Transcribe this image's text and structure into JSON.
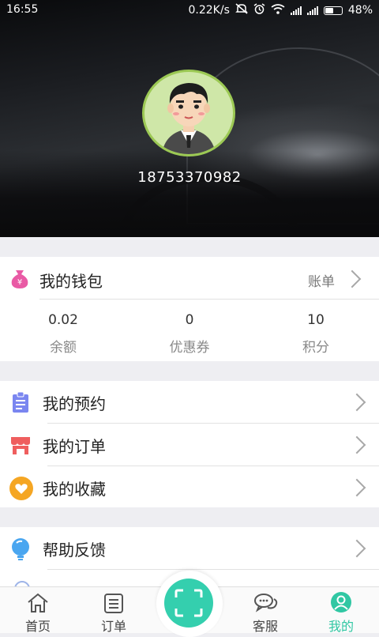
{
  "status_bar": {
    "time": "16:55",
    "speed": "0.22K/s",
    "battery": "48%",
    "battery_level": 0.48
  },
  "profile": {
    "phone": "18753370982"
  },
  "wallet": {
    "title": "我的钱包",
    "bill_link": "账单",
    "stats": [
      {
        "value": "0.02",
        "label": "余额"
      },
      {
        "value": "0",
        "label": "优惠券"
      },
      {
        "value": "10",
        "label": "积分"
      }
    ]
  },
  "menu": {
    "appointment": "我的预约",
    "orders": "我的订单",
    "favorites": "我的收藏",
    "help": "帮助反馈"
  },
  "nav": {
    "home": "首页",
    "orders": "订单",
    "service": "客服",
    "mine": "我的"
  },
  "colors": {
    "accent": "#30c7a3",
    "wallet_icon": "#e95aa5",
    "appointment_icon": "#7a86f0",
    "orders_icon": "#ef5e5e",
    "favorites_icon": "#f5a623",
    "help_icon": "#4aa6f0"
  },
  "icons": {
    "status": [
      "mute-icon",
      "alarm-icon",
      "wifi-icon",
      "signal-icon",
      "signal-icon",
      "battery-icon"
    ],
    "wallet": "money-bag-icon",
    "appointment": "clipboard-icon",
    "orders": "store-icon",
    "favorites": "heart-icon",
    "help": "lightbulb-icon",
    "nav": [
      "home-icon",
      "list-icon",
      "scan-icon",
      "chat-icon",
      "user-icon"
    ]
  }
}
